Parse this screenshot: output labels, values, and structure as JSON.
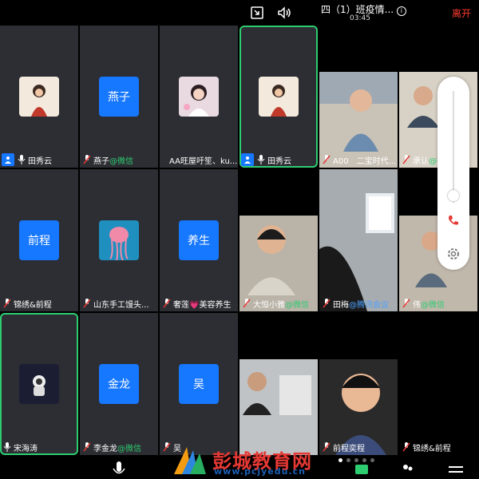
{
  "header": {
    "title": "四（1）班疫情...",
    "timer": "03:45",
    "leave_label": "离开"
  },
  "tiles": [
    {
      "name": "田秀云",
      "avatar_text": "",
      "wechat": false
    },
    {
      "name": "燕子",
      "avatar_text": "燕子",
      "wechat": true
    },
    {
      "name": "AA旺屋吁笙、ku...",
      "avatar_text": "",
      "wechat": false
    },
    {
      "name": "田秀云",
      "avatar_text": "",
      "wechat": false
    },
    {
      "name": "锦绣&前程",
      "avatar_text": "前程",
      "wechat": false
    },
    {
      "name": "山东手工馒头...",
      "avatar_text": "",
      "wechat": false
    },
    {
      "name": "奢莲💗美容养生",
      "avatar_text": "养生",
      "wechat": false
    },
    {
      "name": "大恒小雅",
      "avatar_text": "",
      "wechat": true
    },
    {
      "name": "宋海涛",
      "avatar_text": "",
      "wechat": false
    },
    {
      "name": "李金龙",
      "avatar_text": "金龙",
      "wechat": true
    },
    {
      "name": "吴",
      "avatar_text": "吴",
      "wechat": false
    },
    {
      "name": "前程奕程",
      "avatar_text": "",
      "wechat": false
    }
  ],
  "video_tiles": [
    {
      "name": "A00　二宝时代..."
    },
    {
      "name": "承认",
      "wechat": true
    },
    {
      "name": "田梅"
    },
    {
      "name": "伟",
      "wechat": true
    },
    {
      "name": "锦绣&前程"
    }
  ],
  "wechat_suffix": "@微信",
  "meeting_suffix": "@腾讯会议",
  "watermark": {
    "cn": "彭城教育网",
    "url": "www.pcjyedu.cn"
  },
  "colors": {
    "accent": "#1677ff",
    "active_border": "#2ecc71",
    "leave": "#ff3b30"
  }
}
